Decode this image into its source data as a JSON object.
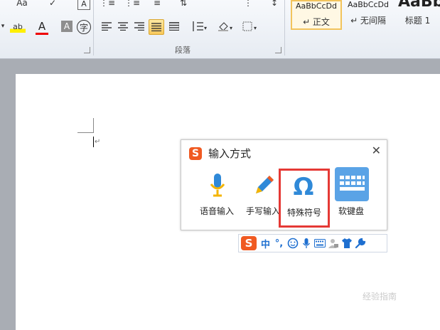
{
  "ribbon": {
    "row1": [
      "Aa",
      "✓",
      "A",
      "⋮≡",
      "⋮≡",
      "≡",
      "⇅",
      "⋮",
      "↕"
    ],
    "row2_font": [
      "ab",
      "A",
      "A",
      "字"
    ],
    "paragraph_group_label": "段落",
    "styles": [
      {
        "preview": "AaBbCcDd",
        "name": "↵ 正文"
      },
      {
        "preview": "AaBbCcDd",
        "name": "↵ 无间隔"
      },
      {
        "preview": "AaBb",
        "name": "标题 1"
      }
    ]
  },
  "document": {
    "paragraph_mark": "↵"
  },
  "input_popup": {
    "logo": "S",
    "title": "输入方式",
    "close": "✕",
    "options": [
      {
        "label": "语音输入",
        "icon": "microphone-icon"
      },
      {
        "label": "手写输入",
        "icon": "pencil-icon"
      },
      {
        "label": "特殊符号",
        "icon": "omega-icon"
      },
      {
        "label": "软键盘",
        "icon": "keyboard-icon"
      }
    ]
  },
  "ime_toolbar": {
    "logo": "S",
    "mode": "中",
    "punct": "°,",
    "items": [
      "smiley-icon",
      "microphone-icon",
      "keyboard-icon",
      "user-icon",
      "shirt-icon",
      "wrench-icon"
    ]
  },
  "watermark": "经验指南",
  "colors": {
    "accent_blue": "#2f89d8",
    "sogou_orange": "#f05a22",
    "highlight_red": "#e53935",
    "mic_yellow": "#f4b400"
  }
}
